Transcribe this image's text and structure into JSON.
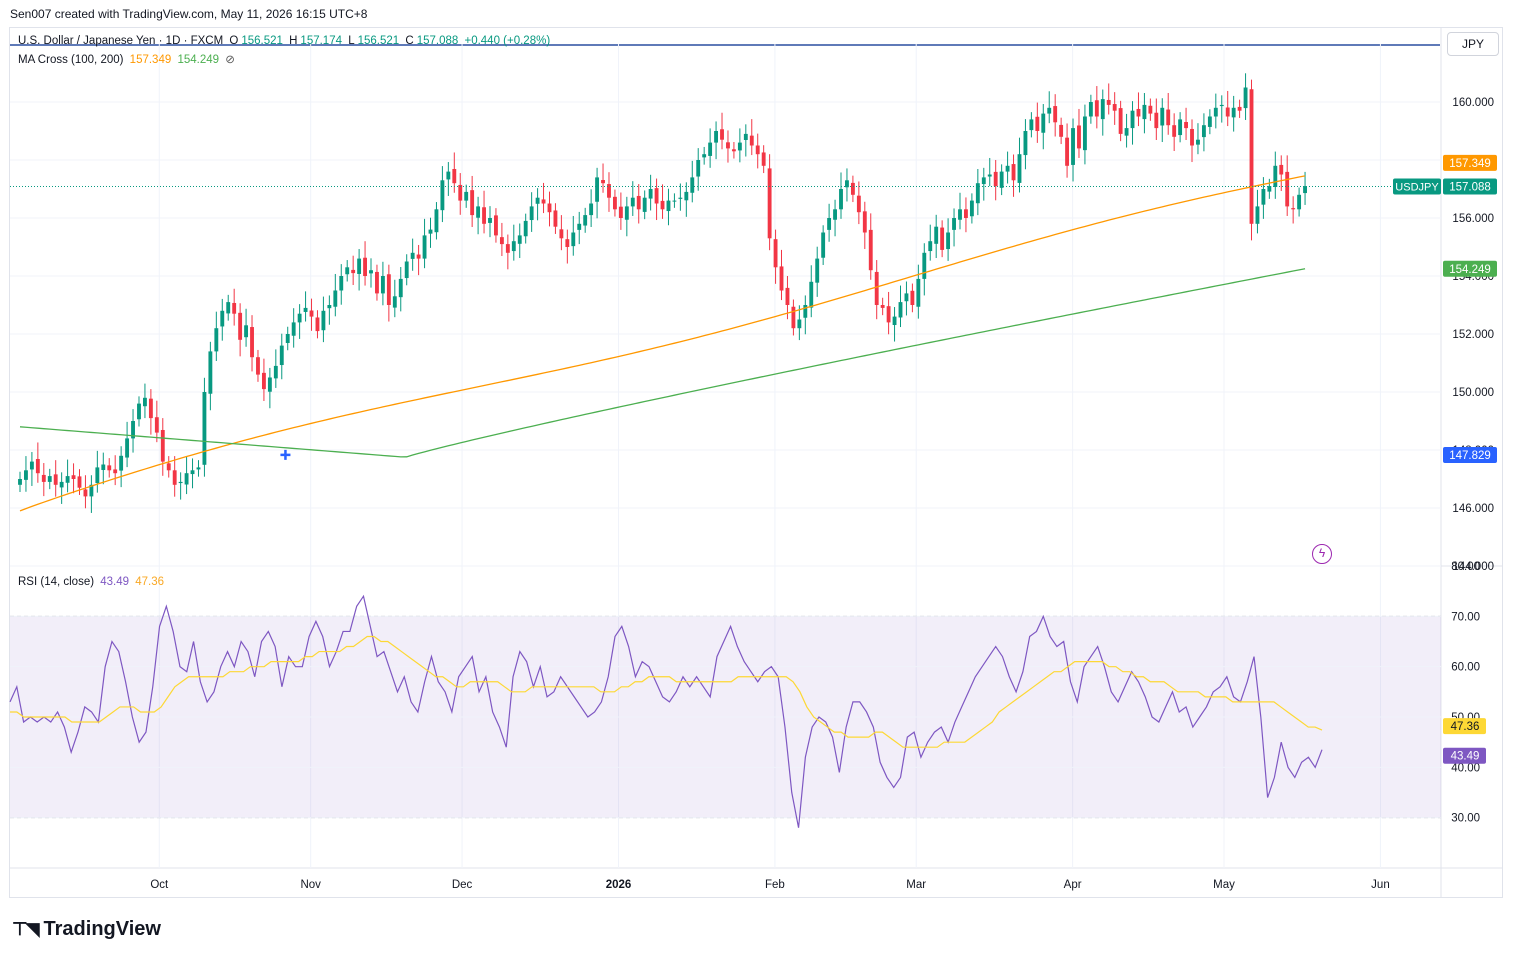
{
  "header": {
    "created_by": "Sen007 created with TradingView.com, May 11, 2026 16:15 UTC+8"
  },
  "legend": {
    "symbol": "U.S. Dollar / Japanese Yen · 1D · FXCM",
    "o_label": "O",
    "o_value": "156.521",
    "h_label": "H",
    "h_value": "157.174",
    "l_label": "L",
    "l_value": "156.521",
    "c_label": "C",
    "c_value": "157.088",
    "change": "+0.440 (+0.28%)",
    "ma_label": "MA Cross (100, 200)",
    "ma_fast": "157.349",
    "ma_slow": "154.249",
    "rsi_label": "RSI (14, close)",
    "rsi_value": "43.49",
    "rsi_ma_value": "47.36"
  },
  "currency_button": "JPY",
  "footer": {
    "brand": "TradingView"
  },
  "colors": {
    "up": "#089981",
    "down": "#f23645",
    "ma_fast": "#ff9800",
    "ma_slow": "#4caf50",
    "rsi": "#7e57c2",
    "rsi_ma": "#fdd835",
    "band": "#7e57c2",
    "last_price": "#089981",
    "cross": "#2962ff"
  },
  "chart_data": [
    {
      "type": "candlestick",
      "symbol": "USDJPY",
      "price_axis": {
        "ticks": [
          "160.000",
          "158.000",
          "156.000",
          "154.000",
          "152.000",
          "150.000",
          "148.000",
          "146.000",
          "144.000"
        ],
        "range": [
          144.0,
          162.0
        ]
      },
      "time_axis": {
        "labels": [
          "Oct",
          "Nov",
          "Dec",
          "2026",
          "Feb",
          "Mar",
          "Apr",
          "May",
          "Jun"
        ],
        "label_positions_days": [
          28,
          58,
          88,
          119,
          150,
          178,
          209,
          239,
          270
        ],
        "range_days": [
          0,
          282
        ]
      },
      "last_price": {
        "label": "USDJPY",
        "value": 157.088
      },
      "price_labels": [
        {
          "value": "157.349",
          "y": 157.349,
          "color": "#ff9800"
        },
        {
          "value": "154.249",
          "y": 154.249,
          "color": "#4caf50"
        },
        {
          "value": "147.829",
          "y": 147.829,
          "color": "#2962ff"
        }
      ],
      "cross_marker": {
        "day": 53,
        "value": 147.83
      },
      "candles_close": [
        147.0,
        147.3,
        147.6,
        147.2,
        146.9,
        147.1,
        146.8,
        146.9,
        147.1,
        147.0,
        146.7,
        146.4,
        146.8,
        147.4,
        147.5,
        147.3,
        147.2,
        147.8,
        148.4,
        149.0,
        149.6,
        149.8,
        149.1,
        148.6,
        147.6,
        147.3,
        146.8,
        146.9,
        147.2,
        147.3,
        147.4,
        150.0,
        151.4,
        152.2,
        152.8,
        153.1,
        152.7,
        151.8,
        152.3,
        151.2,
        150.6,
        150.1,
        150.5,
        150.9,
        151.6,
        152.0,
        152.4,
        152.7,
        152.9,
        152.6,
        152.1,
        152.8,
        153.0,
        153.5,
        154.0,
        154.3,
        154.1,
        154.6,
        154.0,
        154.2,
        153.4,
        154.0,
        153.0,
        153.3,
        153.9,
        154.5,
        154.8,
        154.6,
        155.4,
        155.6,
        156.3,
        157.3,
        157.6,
        157.2,
        156.6,
        156.9,
        156.1,
        156.4,
        155.8,
        156.0,
        155.4,
        155.1,
        154.8,
        155.2,
        155.4,
        155.9,
        156.4,
        156.7,
        156.5,
        156.2,
        155.7,
        155.3,
        155.0,
        155.5,
        155.8,
        156.1,
        156.5,
        157.4,
        157.2,
        156.7,
        156.3,
        156.0,
        156.4,
        156.7,
        156.3,
        156.7,
        157.0,
        156.5,
        156.3,
        156.6,
        156.6,
        156.7,
        156.9,
        157.4,
        158.0,
        158.2,
        158.6,
        159.0,
        158.7,
        158.4,
        158.3,
        158.6,
        158.9,
        158.5,
        158.2,
        157.8,
        155.3,
        154.3,
        153.5,
        153.0,
        152.2,
        152.5,
        153.0,
        153.8,
        154.6,
        155.5,
        156.0,
        156.3,
        157.0,
        157.3,
        156.8,
        156.2,
        155.5,
        154.2,
        153.0,
        152.9,
        152.4,
        152.6,
        153.1,
        153.4,
        153.0,
        153.9,
        154.8,
        155.2,
        155.7,
        154.9,
        155.5,
        156.0,
        156.3,
        156.0,
        156.6,
        157.2,
        157.4,
        157.5,
        157.1,
        157.6,
        157.8,
        157.3,
        158.2,
        159.0,
        159.4,
        159.0,
        159.6,
        159.8,
        159.3,
        158.8,
        157.8,
        159.1,
        158.4,
        159.5,
        160.0,
        159.5,
        160.1,
        159.9,
        159.7,
        158.9,
        159.1,
        159.7,
        159.5,
        159.9,
        159.6,
        159.1,
        159.8,
        159.2,
        158.8,
        159.4,
        159.1,
        158.5,
        158.7,
        159.2,
        159.5,
        159.8,
        159.9,
        159.5,
        159.8,
        159.7,
        160.5,
        155.8,
        156.4,
        157.0,
        157.1,
        157.8,
        157.5,
        156.4,
        156.3,
        156.8,
        157.1
      ]
    },
    {
      "type": "line",
      "title": "RSI (14, close)",
      "y_axis": {
        "ticks": [
          "80.00",
          "70.00",
          "60.00",
          "50.00",
          "40.00",
          "30.00"
        ],
        "range": [
          20,
          80
        ]
      },
      "band": [
        30,
        70
      ],
      "midline": 50,
      "series": [
        {
          "name": "RSI",
          "value_label": "43.49",
          "values": [
            53,
            56,
            49,
            50,
            49,
            50,
            49,
            51,
            48,
            43,
            47,
            52,
            51,
            49,
            60,
            65,
            63,
            57,
            50,
            45,
            47,
            56,
            68,
            72,
            67,
            60,
            59,
            65,
            57,
            53,
            55,
            60,
            63,
            60,
            65,
            63,
            58,
            65,
            67,
            64,
            56,
            62,
            60,
            60,
            66,
            69,
            66,
            60,
            63,
            67,
            67,
            72,
            74,
            68,
            62,
            63,
            59,
            55,
            58,
            53,
            51,
            57,
            62,
            57,
            55,
            51,
            58,
            60,
            62,
            55,
            58,
            51,
            48,
            44,
            58,
            63,
            61,
            56,
            60,
            54,
            55,
            58,
            56,
            54,
            52,
            50,
            51,
            53,
            58,
            66,
            68,
            64,
            58,
            61,
            60,
            57,
            54,
            53,
            55,
            58,
            56,
            58,
            56,
            54,
            62,
            65,
            68,
            64,
            61,
            59,
            57,
            59,
            60,
            58,
            48,
            35,
            28,
            42,
            48,
            50,
            49,
            46,
            39,
            48,
            53,
            53,
            51,
            48,
            41,
            38,
            36,
            38,
            46,
            47,
            42,
            45,
            47,
            48,
            45,
            49,
            52,
            55,
            58,
            60,
            62,
            64,
            62,
            58,
            55,
            59,
            66,
            67,
            70,
            66,
            64,
            65,
            57,
            53,
            60,
            62,
            64,
            60,
            55,
            53,
            56,
            59,
            57,
            54,
            50,
            49,
            52,
            55,
            51,
            52,
            48,
            50,
            52,
            55,
            56,
            58,
            54,
            53,
            57,
            62,
            50,
            34,
            38,
            45,
            40,
            38,
            41,
            42,
            40,
            43.5
          ]
        },
        {
          "name": "RSI-based MA",
          "value_label": "47.36",
          "values": [
            51,
            51,
            50,
            50,
            50,
            50,
            50,
            50,
            50,
            49,
            49,
            49,
            49,
            49,
            50,
            51,
            52,
            52,
            52,
            51,
            51,
            51,
            52,
            54,
            56,
            57,
            58,
            58,
            58,
            58,
            58,
            58,
            59,
            59,
            59,
            60,
            60,
            60,
            61,
            61,
            61,
            61,
            61,
            62,
            62,
            63,
            63,
            63,
            63,
            64,
            64,
            65,
            66,
            66,
            65,
            65,
            64,
            63,
            62,
            61,
            60,
            59,
            58,
            58,
            57,
            56,
            56,
            57,
            57,
            57,
            57,
            57,
            56,
            55,
            55,
            55,
            56,
            56,
            56,
            56,
            56,
            56,
            56,
            56,
            56,
            56,
            55,
            55,
            55,
            56,
            56,
            57,
            57,
            58,
            58,
            58,
            58,
            57,
            57,
            57,
            57,
            57,
            57,
            57,
            57,
            57,
            58,
            58,
            58,
            58,
            58,
            58,
            58,
            58,
            57,
            55,
            52,
            50,
            49,
            48,
            47,
            47,
            46,
            46,
            46,
            46,
            47,
            47,
            46,
            45,
            44,
            44,
            44,
            44,
            44,
            44,
            45,
            45,
            45,
            45,
            46,
            47,
            48,
            49,
            51,
            52,
            53,
            54,
            55,
            56,
            57,
            58,
            59,
            59,
            60,
            61,
            61,
            61,
            61,
            61,
            60,
            60,
            59,
            59,
            58,
            58,
            57,
            57,
            57,
            56,
            55,
            55,
            55,
            55,
            54,
            54,
            54,
            54,
            53,
            53,
            53,
            53,
            53,
            53,
            53,
            52,
            51,
            50,
            49,
            48,
            48,
            47.4
          ]
        }
      ]
    }
  ]
}
